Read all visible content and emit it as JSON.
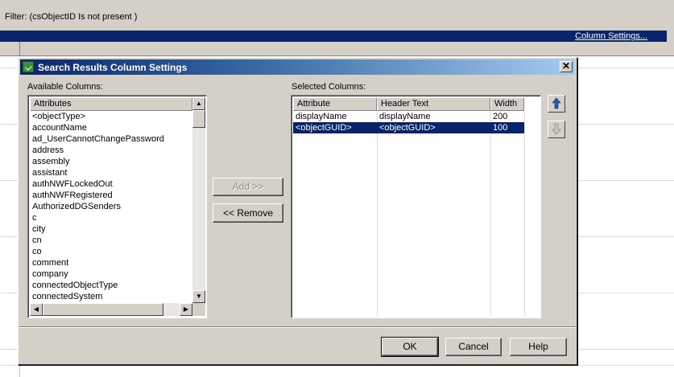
{
  "background": {
    "filter_text": "Filter: (csObjectID Is not present )",
    "column_settings_link": "Column Settings..."
  },
  "dialog": {
    "title": "Search Results Column Settings",
    "available_label": "Available Columns:",
    "selected_label": "Selected Columns:",
    "available_header": "Attributes",
    "available_items": [
      "<objectType>",
      "accountName",
      "ad_UserCannotChangePassword",
      "address",
      "assembly",
      "assistant",
      "authNWFLockedOut",
      "authNWFRegistered",
      "AuthorizedDGSenders",
      "c",
      "city",
      "cn",
      "co",
      "comment",
      "company",
      "connectedObjectType",
      "connectedSystem"
    ],
    "selected_headers": [
      "Attribute",
      "Header Text",
      "Width"
    ],
    "selected_rows": [
      {
        "attribute": "displayName",
        "header_text": "displayName",
        "width": "200"
      },
      {
        "attribute": "<objectGUID>",
        "header_text": "<objectGUID>",
        "width": "100"
      }
    ],
    "selected_row_index": 1,
    "add_button": "Add >>",
    "remove_button": "<< Remove",
    "ok_button": "OK",
    "cancel_button": "Cancel",
    "help_button": "Help",
    "icons": {
      "move_up": "arrow-up-icon",
      "move_down": "arrow-down-icon",
      "close": "close-icon"
    }
  },
  "colors": {
    "selection": "#0a246a",
    "face": "#d4d0c8"
  }
}
